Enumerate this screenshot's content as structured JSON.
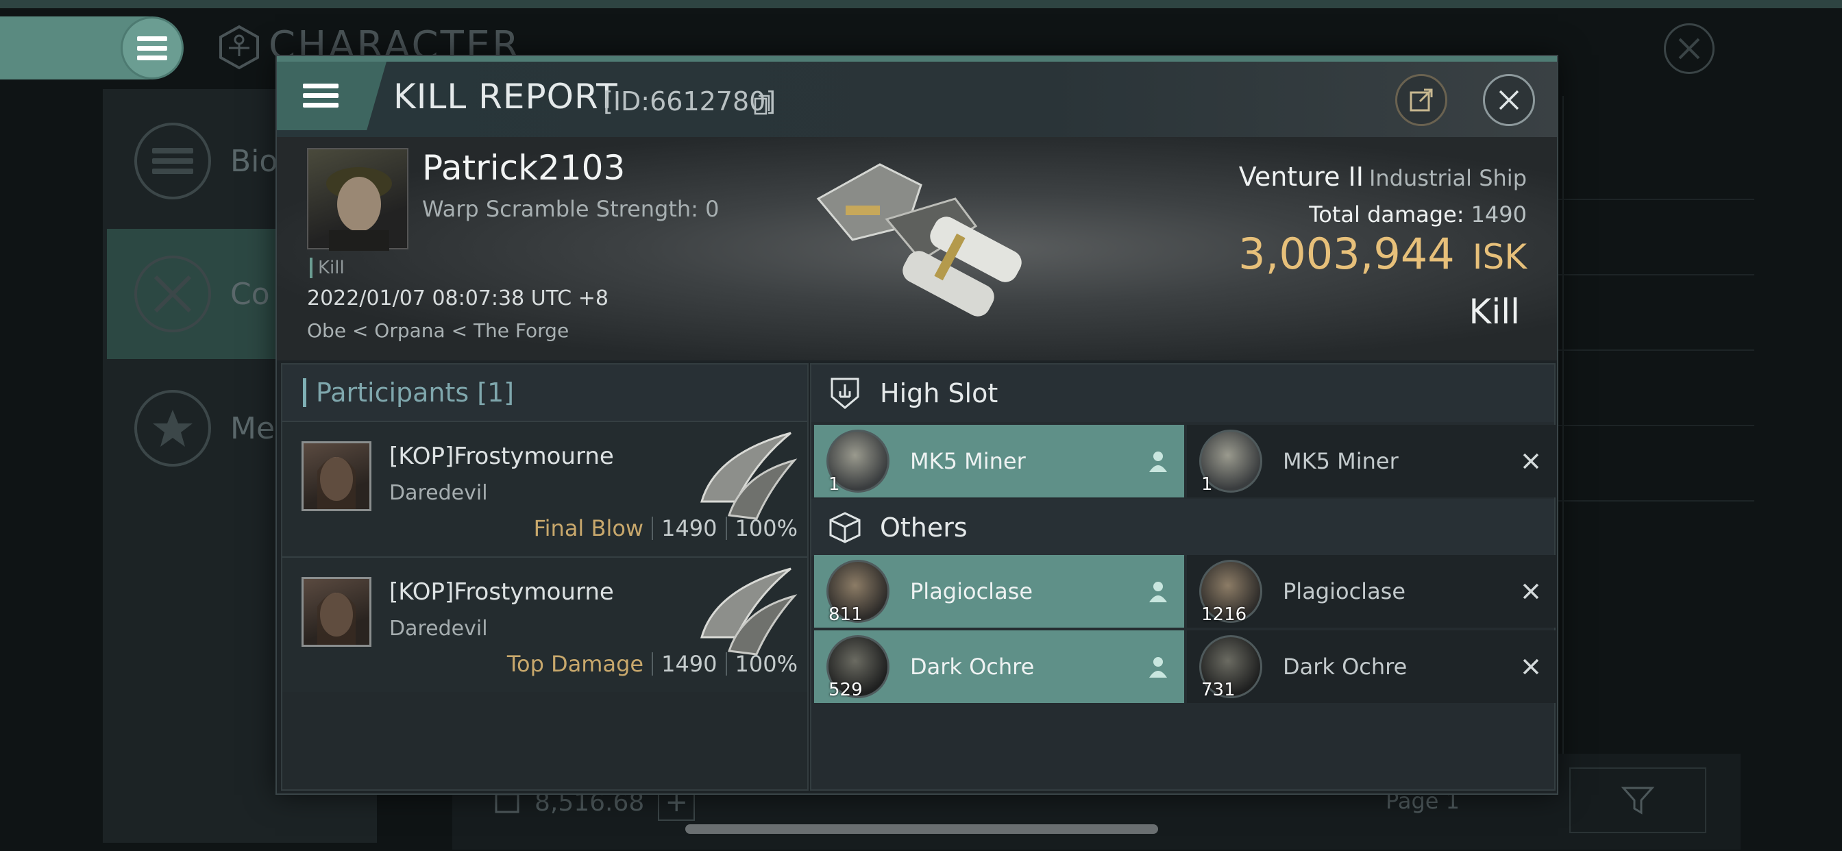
{
  "background": {
    "title": "CHARACTER",
    "sidebar": [
      {
        "label": "Bio"
      },
      {
        "label": "Co"
      },
      {
        "label": "Me"
      }
    ],
    "wallet_value": "8,516.68",
    "page_label": "Page 1"
  },
  "modal": {
    "title": "KILL REPORT",
    "id_label": "[ID:6612780]",
    "victim": {
      "name": "Patrick2103",
      "warp_scramble": "Warp Scramble Strength: 0",
      "tag": "Kill",
      "datetime": "2022/01/07 08:07:38 UTC +8",
      "location": "Obe < Orpana < The Forge",
      "ship_name": "Venture II",
      "ship_class": "Industrial Ship",
      "total_damage_label": "Total damage:",
      "total_damage_value": "1490",
      "isk_value": "3,003,944",
      "isk_unit": "ISK",
      "result": "Kill"
    },
    "participants": {
      "header": "Participants [1]",
      "rows": [
        {
          "name": "[KOP]Frostymourne",
          "ship": "Daredevil",
          "label": "Final Blow",
          "damage": "1490",
          "percent": "100%"
        },
        {
          "name": "[KOP]Frostymourne",
          "ship": "Daredevil",
          "label": "Top Damage",
          "damage": "1490",
          "percent": "100%"
        }
      ]
    },
    "fitting": {
      "high_slot": {
        "title": "High Slot",
        "dropped": [
          {
            "name": "MK5 Miner",
            "qty": "1"
          }
        ],
        "destroyed": [
          {
            "name": "MK5 Miner",
            "qty": "1"
          }
        ]
      },
      "others": {
        "title": "Others",
        "dropped": [
          {
            "name": "Plagioclase",
            "qty": "811"
          },
          {
            "name": "Dark Ochre",
            "qty": "529"
          }
        ],
        "destroyed": [
          {
            "name": "Plagioclase",
            "qty": "1216"
          },
          {
            "name": "Dark Ochre",
            "qty": "731"
          }
        ]
      }
    }
  },
  "colors": {
    "accent": "#5f9088",
    "isk": "#e7c07a",
    "label_gold": "#c8a86c"
  }
}
